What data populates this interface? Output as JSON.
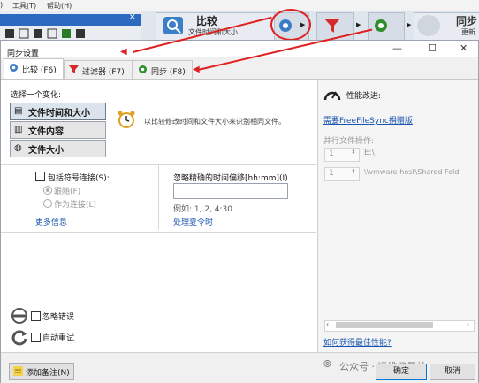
{
  "background_app": {
    "menu": [
      "工具(T)",
      "帮助(H)"
    ],
    "menu_prefix": ")",
    "compare_button": {
      "label": "比较",
      "sublabel": "文件时间和大小"
    },
    "sync_button": {
      "label": "同步",
      "sublabel": "更新"
    }
  },
  "dialog": {
    "title": "同步设置",
    "tabs": [
      {
        "label": "比较 (F6)",
        "icon": "gear-blue-icon"
      },
      {
        "label": "过滤器 (F7)",
        "icon": "filter-icon"
      },
      {
        "label": "同步 (F8)",
        "icon": "gear-green-icon"
      }
    ],
    "compare": {
      "select_variant_label": "选择一个变化:",
      "variants": [
        {
          "label": "文件时间和大小",
          "icon": "clock-file-icon",
          "selected": true
        },
        {
          "label": "文件内容",
          "icon": "file-content-icon",
          "selected": false
        },
        {
          "label": "文件大小",
          "icon": "file-size-icon",
          "selected": false
        }
      ],
      "description": "以比较修改时间和文件大小来识别相同文件。",
      "symlinks_label": "包括符号连接(S):",
      "symlink_options": [
        "跟随(F)",
        "作为连接(L)"
      ],
      "more_info_link": "更多信息",
      "ignore_time_shift_label": "忽略精确的时间偏移[hh:mm](I)",
      "ignore_time_shift_value": "",
      "example_text": "例如: 1, 2, 4:30",
      "dst_link": "处理夏令时",
      "ignore_errors_label": "忽略错误",
      "auto_retry_label": "自动重试"
    },
    "performance": {
      "title": "性能改进:",
      "link": "需要FreeFileSync捐赠版",
      "parallel_ops_label": "并行文件操作:",
      "rows": [
        {
          "count": "1",
          "path": "E:\\"
        },
        {
          "count": "1",
          "path": "\\\\vmware-host\\Shared Fold"
        }
      ],
      "bottom_link": "如何获得最佳性能?"
    },
    "footer": {
      "add_note_button": "添加备注(N)",
      "ok_button": "确定",
      "cancel_button": "取消",
      "watermark": "公众号 · 运维能量站"
    }
  },
  "colors": {
    "annotation_red": "#e02020",
    "link_blue": "#1a56b0",
    "titlebar_blue": "#2b6ac0"
  }
}
